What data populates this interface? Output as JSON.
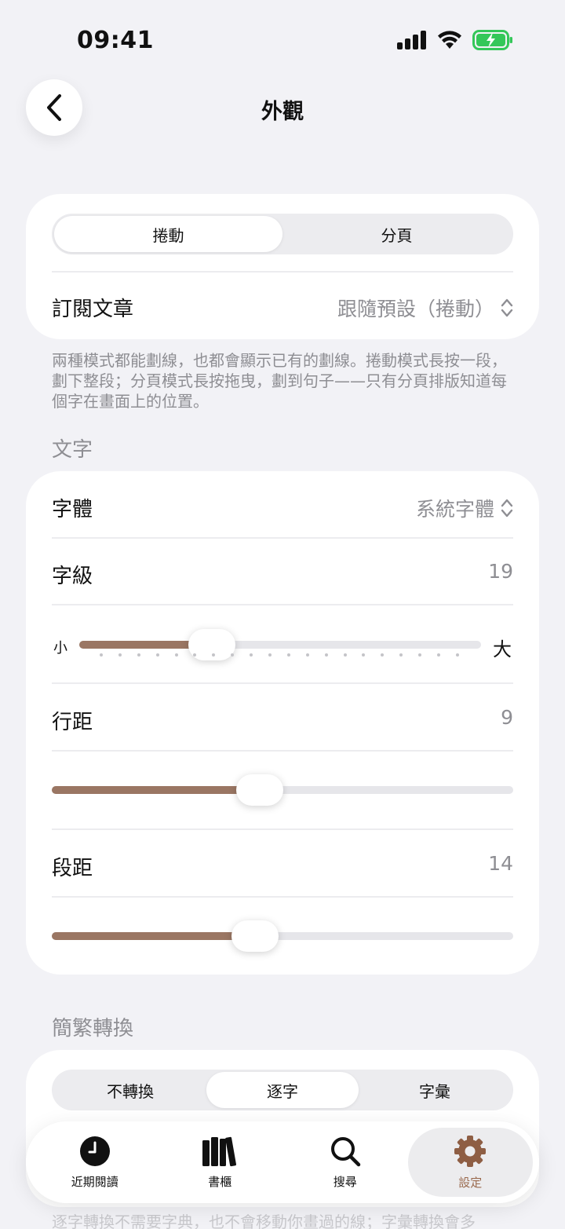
{
  "status": {
    "time": "09:41"
  },
  "nav": {
    "title": "外觀"
  },
  "layout_mode": {
    "options": [
      "捲動",
      "分頁"
    ],
    "selected": "捲動",
    "subscription_label": "訂閱文章",
    "subscription_value": "跟隨預設（捲動）"
  },
  "note": "兩種模式都能劃線，也都會顯示已有的劃線。捲動模式長按一段，劃下整段；分頁模式長按拖曳，劃到句子——只有分頁排版知道每個字在畫面上的位置。",
  "text_section": {
    "header": "文字",
    "font_label": "字體",
    "font_value": "系統字體",
    "size_label": "字級",
    "size_value": "19",
    "size_min_label": "小",
    "size_max_label": "大",
    "size_level": 0.33,
    "line_spacing_label": "行距",
    "line_spacing_value": "9",
    "line_spacing_level": 0.45,
    "para_spacing_label": "段距",
    "para_spacing_value": "14",
    "para_spacing_level": 0.44
  },
  "conversion": {
    "header": "簡繁轉換",
    "options": [
      "不轉換",
      "逐字",
      "字彙"
    ],
    "selected": "逐字",
    "footnote": "逐字轉換不需要字典，也不會移動你畫過的線；字彙轉換會多"
  },
  "tabs": [
    {
      "label": "近期閱讀",
      "icon": "clock-icon"
    },
    {
      "label": "書櫃",
      "icon": "bookshelf-icon"
    },
    {
      "label": "搜尋",
      "icon": "search-icon"
    },
    {
      "label": "設定",
      "icon": "gear-icon",
      "active": true
    }
  ],
  "colors": {
    "accent": "#9a7663",
    "background": "#f2f2f6",
    "battery": "#34c759"
  }
}
